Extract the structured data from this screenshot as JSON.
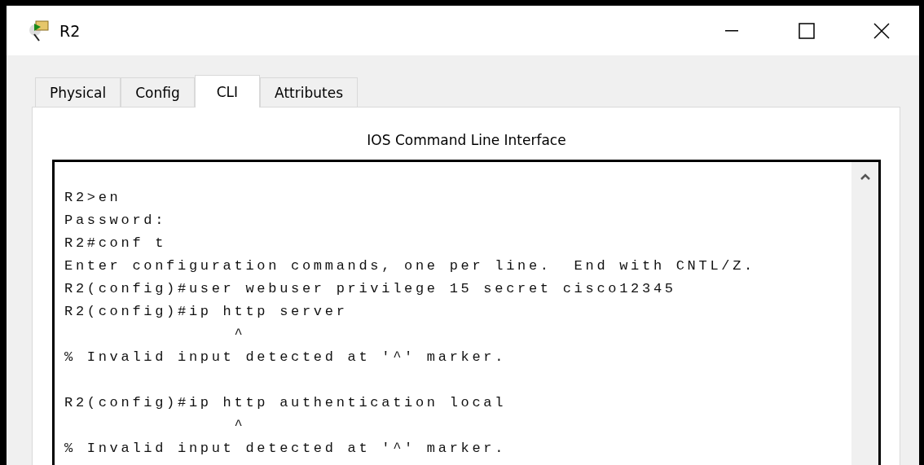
{
  "window": {
    "title": "R2"
  },
  "tabs": [
    {
      "label": "Physical",
      "selected": false
    },
    {
      "label": "Config",
      "selected": false
    },
    {
      "label": "CLI",
      "selected": true
    },
    {
      "label": "Attributes",
      "selected": false
    }
  ],
  "panel_title": "IOS Command Line Interface",
  "terminal": {
    "blocks": [
      [
        "R2>en",
        "Password:",
        "R2#conf t",
        "Enter configuration commands, one per line.  End with CNTL/Z.",
        "R2(config)#user webuser privilege 15 secret cisco12345",
        "R2(config)#ip http server",
        "               ^",
        "% Invalid input detected at '^' marker."
      ],
      [
        "R2(config)#ip http authentication local",
        "               ^",
        "% Invalid input detected at '^' marker."
      ]
    ]
  }
}
